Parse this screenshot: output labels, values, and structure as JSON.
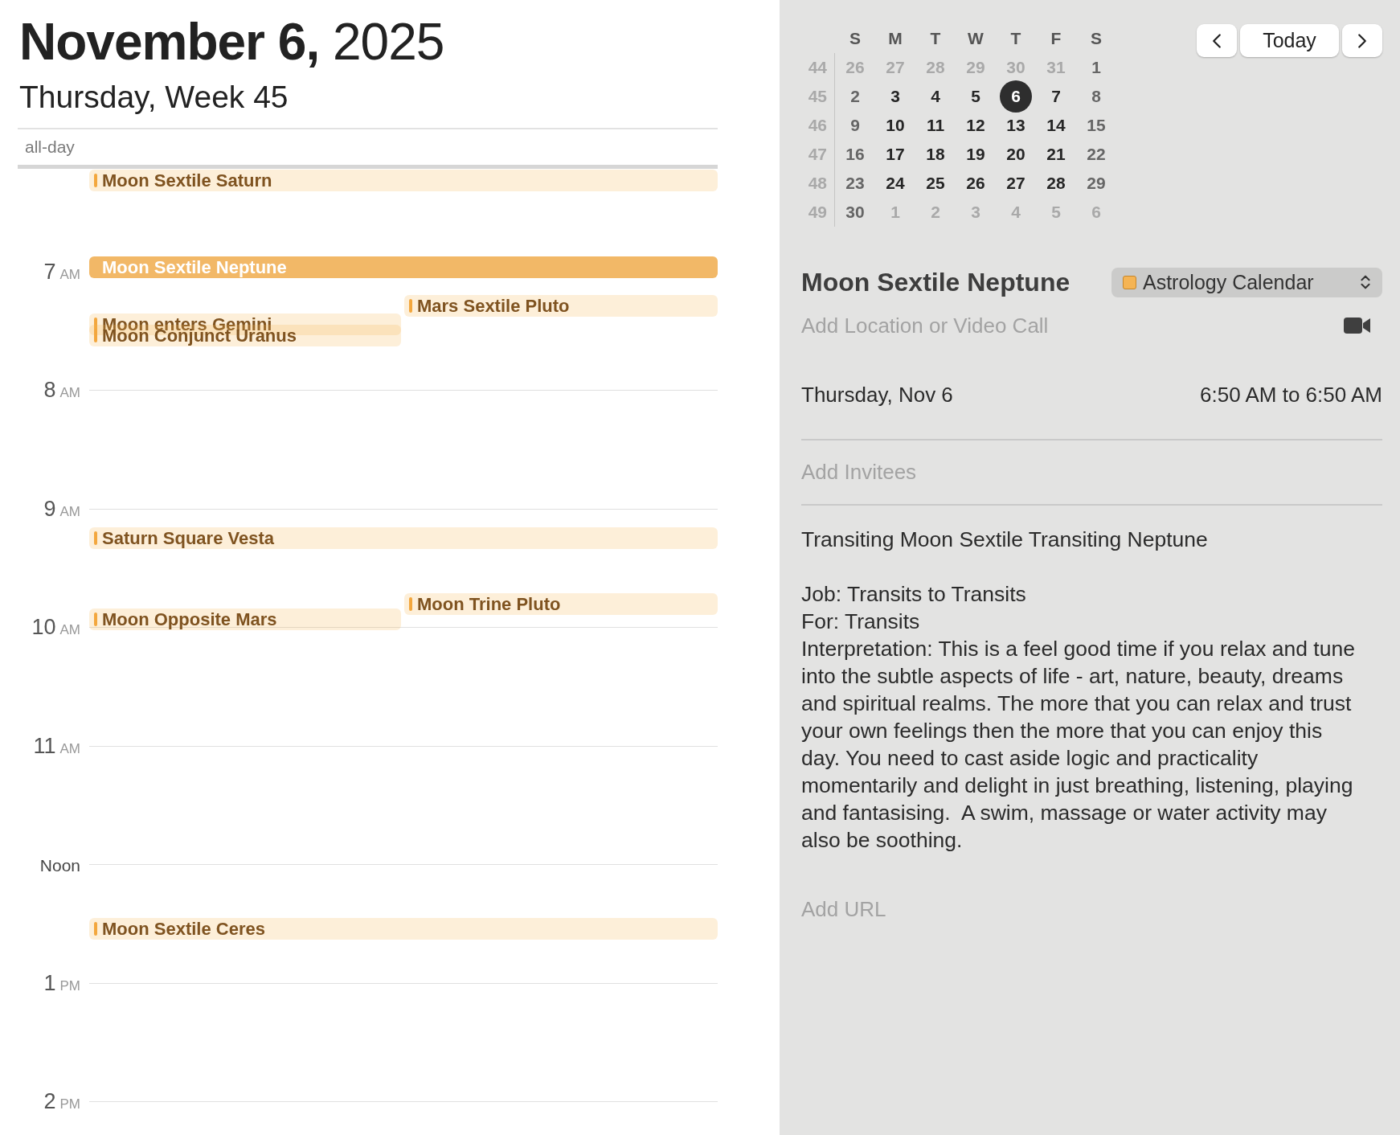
{
  "header": {
    "date": "**November 6,** 2025",
    "subtitle": "Thursday, Week 45"
  },
  "all_day_label": "all-day",
  "hours": [
    {
      "hour": "7",
      "period": "AM"
    },
    {
      "hour": "8",
      "period": "AM"
    },
    {
      "hour": "9",
      "period": "AM"
    },
    {
      "hour": "10",
      "period": "AM"
    },
    {
      "hour": "11",
      "period": "AM"
    },
    {
      "hour": "Noon"
    },
    {
      "hour": "1",
      "period": "PM"
    },
    {
      "hour": "2",
      "period": "PM"
    }
  ],
  "events": [
    {
      "title": "Moon Sextile Saturn",
      "selected": false
    },
    {
      "title": "Moon Sextile Neptune",
      "selected": true
    },
    {
      "title": "Mars Sextile Pluto",
      "selected": false
    },
    {
      "title": "Moon enters Gemini",
      "selected": false
    },
    {
      "title": "Moon Conjunct Uranus",
      "selected": false
    },
    {
      "title": "Saturn Square Vesta",
      "selected": false
    },
    {
      "title": "Moon Trine Pluto",
      "selected": false
    },
    {
      "title": "Moon Opposite Mars",
      "selected": false
    },
    {
      "title": "Moon Sextile Ceres",
      "selected": false
    }
  ],
  "mini_calendar": {
    "weekdays": [
      "S",
      "M",
      "T",
      "W",
      "T",
      "F",
      "S"
    ],
    "weeks": [
      {
        "number": "44",
        "days": [
          {
            "day": "26",
            "muted": true,
            "selected": false
          },
          {
            "day": "27",
            "muted": true,
            "selected": false
          },
          {
            "day": "28",
            "muted": true,
            "selected": false
          },
          {
            "day": "29",
            "muted": true,
            "selected": false
          },
          {
            "day": "30",
            "muted": true,
            "selected": false
          },
          {
            "day": "31",
            "muted": true,
            "selected": false
          },
          {
            "day": "1",
            "muted": false,
            "selected": false
          }
        ]
      },
      {
        "number": "45",
        "days": [
          {
            "day": "2",
            "muted": false,
            "selected": false
          },
          {
            "day": "3",
            "muted": false,
            "selected": false
          },
          {
            "day": "4",
            "muted": false,
            "selected": false
          },
          {
            "day": "5",
            "muted": false,
            "selected": false
          },
          {
            "day": "6",
            "muted": false,
            "selected": true
          },
          {
            "day": "7",
            "muted": false,
            "selected": false
          },
          {
            "day": "8",
            "muted": false,
            "selected": false
          }
        ]
      },
      {
        "number": "46",
        "days": [
          {
            "day": "9",
            "muted": false,
            "selected": false
          },
          {
            "day": "10",
            "muted": false,
            "selected": false
          },
          {
            "day": "11",
            "muted": false,
            "selected": false
          },
          {
            "day": "12",
            "muted": false,
            "selected": false
          },
          {
            "day": "13",
            "muted": false,
            "selected": false
          },
          {
            "day": "14",
            "muted": false,
            "selected": false
          },
          {
            "day": "15",
            "muted": false,
            "selected": false
          }
        ]
      },
      {
        "number": "47",
        "days": [
          {
            "day": "16",
            "muted": false,
            "selected": false
          },
          {
            "day": "17",
            "muted": false,
            "selected": false
          },
          {
            "day": "18",
            "muted": false,
            "selected": false
          },
          {
            "day": "19",
            "muted": false,
            "selected": false
          },
          {
            "day": "20",
            "muted": false,
            "selected": false
          },
          {
            "day": "21",
            "muted": false,
            "selected": false
          },
          {
            "day": "22",
            "muted": false,
            "selected": false
          }
        ]
      },
      {
        "number": "48",
        "days": [
          {
            "day": "23",
            "muted": false,
            "selected": false
          },
          {
            "day": "24",
            "muted": false,
            "selected": false
          },
          {
            "day": "25",
            "muted": false,
            "selected": false
          },
          {
            "day": "26",
            "muted": false,
            "selected": false
          },
          {
            "day": "27",
            "muted": false,
            "selected": false
          },
          {
            "day": "28",
            "muted": false,
            "selected": false
          },
          {
            "day": "29",
            "muted": false,
            "selected": false
          }
        ]
      },
      {
        "number": "49",
        "days": [
          {
            "day": "30",
            "muted": false,
            "selected": false
          },
          {
            "day": "1",
            "muted": true,
            "selected": false
          },
          {
            "day": "2",
            "muted": true,
            "selected": false
          },
          {
            "day": "3",
            "muted": true,
            "selected": false
          },
          {
            "day": "4",
            "muted": true,
            "selected": false
          },
          {
            "day": "5",
            "muted": true,
            "selected": false
          },
          {
            "day": "6",
            "muted": true,
            "selected": false
          }
        ]
      }
    ]
  },
  "nav": {
    "today": "Today"
  },
  "details": {
    "title": "Moon Sextile Neptune",
    "calendar": {
      "name": "Astrology Calendar",
      "color": "#f5b454"
    },
    "location_placeholder": "Add Location or Video Call",
    "date": "Thursday, Nov 6",
    "time": "6:50 AM to 6:50 AM",
    "invitees_placeholder": "Add Invitees",
    "notes": "Transiting Moon Sextile Transiting Neptune\n\nJob: Transits to Transits\nFor: Transits\nInterpretation: This is a feel good time if you relax and tune into the subtle aspects of life - art, nature, beauty, dreams and spiritual realms. The more that you can relax and trust your own feelings then the more that you can enjoy this day. You need to cast aside logic and practicality momentarily and delight in just breathing, listening, playing and fantasising.  A swim, massage or water activity may also be soothing.",
    "url_placeholder": "Add URL"
  }
}
